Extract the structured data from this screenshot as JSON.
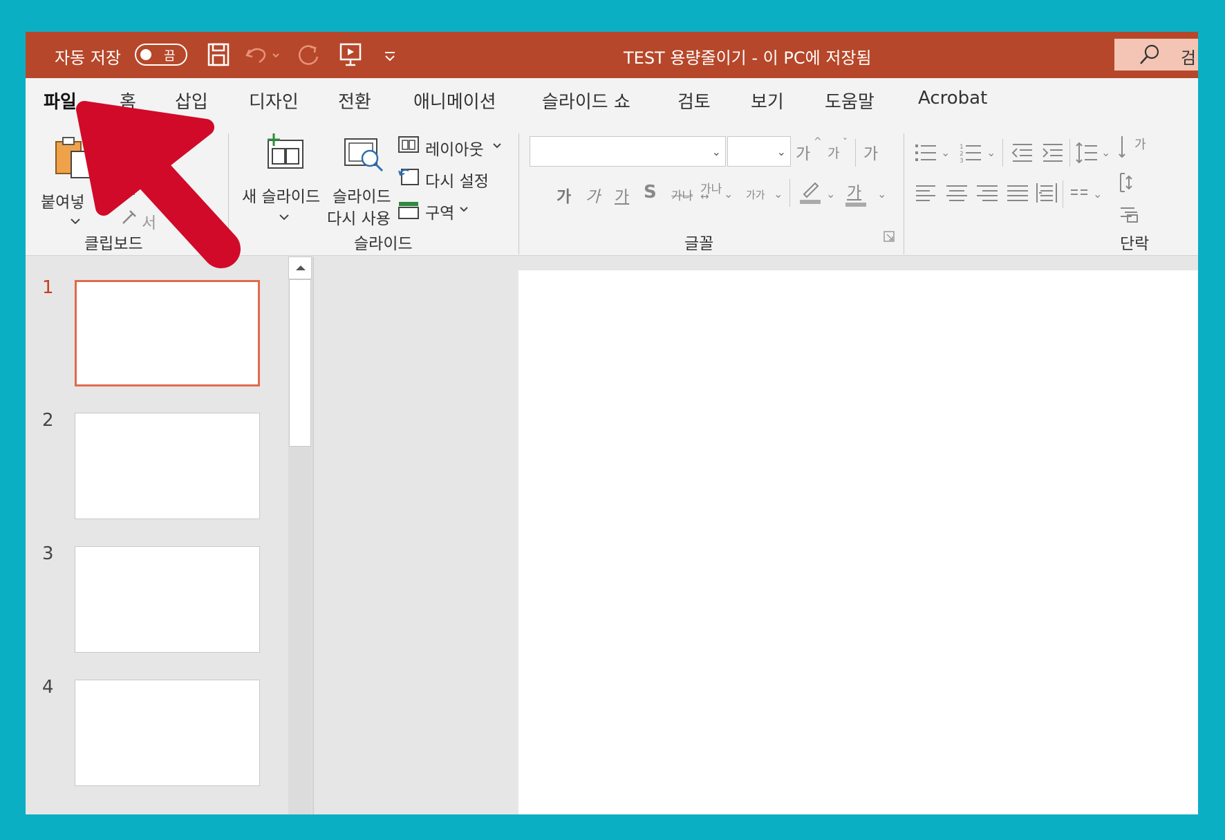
{
  "titlebar": {
    "autosave_label": "자동 저장",
    "autosave_state": "끔",
    "doc_title": "TEST 용량줄이기 - 이 PC에 저장됨",
    "search_label": "검"
  },
  "tabs": [
    {
      "label": "파일",
      "active": true
    },
    {
      "label": "홈"
    },
    {
      "label": "삽입"
    },
    {
      "label": "디자인"
    },
    {
      "label": "전환"
    },
    {
      "label": "애니메이션"
    },
    {
      "label": "슬라이드 쇼"
    },
    {
      "label": "검토"
    },
    {
      "label": "보기"
    },
    {
      "label": "도움말"
    },
    {
      "label": "Acrobat"
    }
  ],
  "ribbon": {
    "clipboard": {
      "paste_label": "붙여넣",
      "format_painter_label": "서",
      "group_label": "클립보드"
    },
    "slides": {
      "new_slide_label": "새 슬라이드",
      "reuse_slide_label_1": "슬라이드",
      "reuse_slide_label_2": "다시 사용",
      "layout_label": "레이아웃",
      "reset_label": "다시 설정",
      "section_label": "구역",
      "group_label": "슬라이드"
    },
    "font": {
      "bold": "가",
      "italic": "가",
      "underline": "가",
      "shadow": "S",
      "strike": "가나",
      "spacing": "가나",
      "case": "가가",
      "grow": "가",
      "shrink": "가",
      "clear": "가",
      "color_glyph": "가",
      "group_label": "글꼴"
    },
    "paragraph": {
      "direction_glyph": "가",
      "group_label": "단락"
    }
  },
  "slides": [
    {
      "number": "1",
      "active": true
    },
    {
      "number": "2"
    },
    {
      "number": "3"
    },
    {
      "number": "4"
    }
  ],
  "colors": {
    "accent": "#b7472a",
    "frame": "#0bafc4",
    "pointer_arrow": "#d10a2a"
  }
}
